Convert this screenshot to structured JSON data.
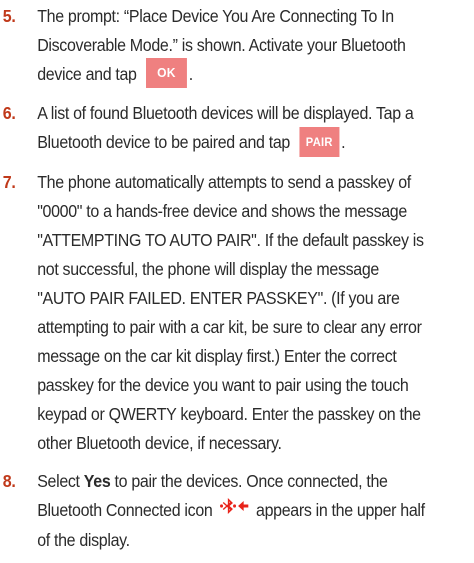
{
  "colors": {
    "step_number": "#c0391a",
    "button_bg": "#ef8080",
    "button_text": "#ffffff",
    "body_text": "#2b2b2b",
    "icon_red": "#e8231a"
  },
  "steps": [
    {
      "number": "5.",
      "text_before": "The prompt: “Place Device You Are Connecting To In Discoverable Mode.” is shown. Activate your Bluetooth device and tap",
      "button": "OK",
      "text_after": "."
    },
    {
      "number": "6.",
      "text_before": "A list of found Bluetooth devices will be displayed. Tap a Bluetooth device to be paired and tap",
      "button": "PAIR",
      "text_after": "."
    },
    {
      "number": "7.",
      "text": "The phone automatically attempts to send a passkey of \"0000\" to a hands-free device and shows the message \"ATTEMPTING TO AUTO PAIR\". If the default passkey is not successful, the phone will display the message \"AUTO PAIR FAILED. ENTER PASSKEY\". (If you are attempting to pair with a car kit, be sure to clear any error message on the car kit display first.) Enter the correct passkey for the device you want to pair using the touch keypad or QWERTY keyboard. Enter the passkey on the other Bluetooth device, if necessary."
    },
    {
      "number": "8.",
      "text_before": "Select",
      "bold_word": "Yes",
      "text_middle": "to pair the devices. Once connected, the Bluetooth Connected icon",
      "icon": "bluetooth-connected-icon",
      "text_after": "appears in the upper half of the display."
    }
  ]
}
